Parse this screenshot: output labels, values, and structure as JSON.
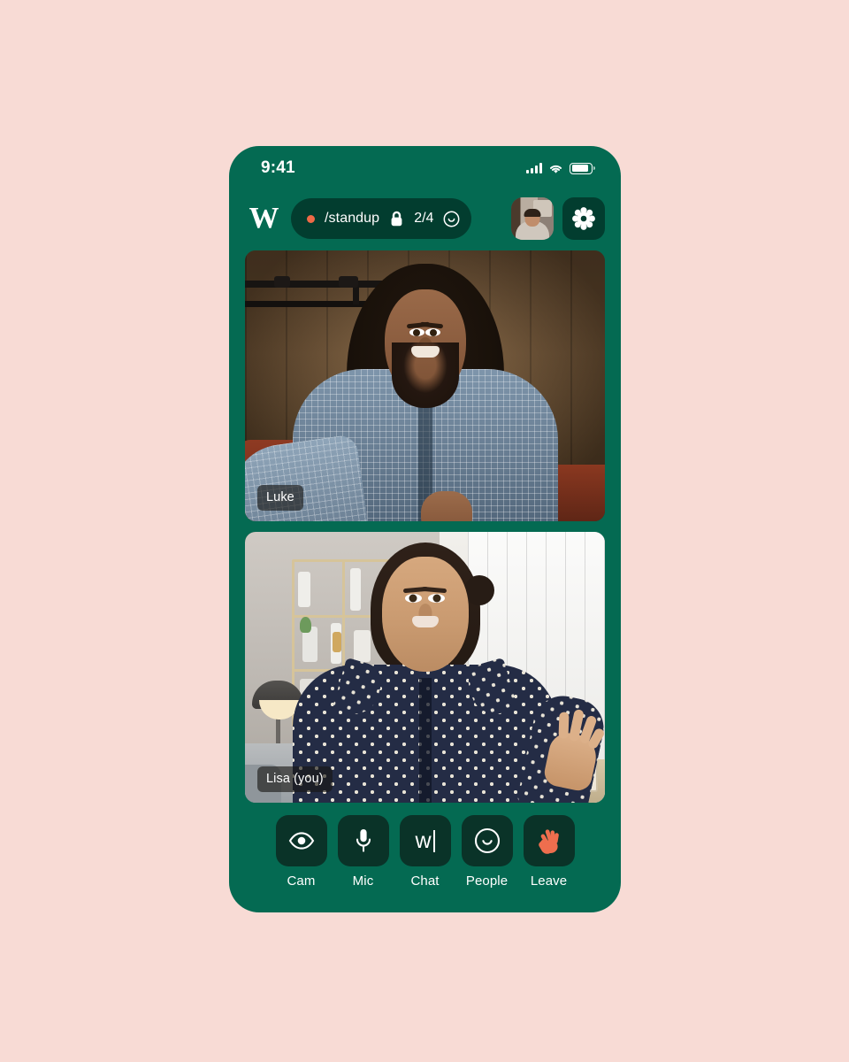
{
  "app": {
    "brand_letter": "W",
    "accent_green": "#046a52",
    "panel_green": "#023d2f",
    "button_green": "#0a3328",
    "page_background": "#f8dbd5",
    "accent_orange": "#ef6a47"
  },
  "status_bar": {
    "time": "9:41",
    "signal_icon": "cellular-signal-icon",
    "wifi_icon": "wifi-icon",
    "battery_icon": "battery-icon"
  },
  "header": {
    "logo_name": "wherebly-logo",
    "room": {
      "recording_dot": "recording-dot",
      "name": "/standup",
      "lock_icon": "lock-icon",
      "participants": "2/4",
      "face_icon": "smiley-face-icon"
    },
    "avatar_name": "self-avatar",
    "settings_icon": "gear-icon"
  },
  "participants": [
    {
      "name": "Luke",
      "tile": "video-tile-luke"
    },
    {
      "name": "Lisa (you)",
      "tile": "video-tile-lisa"
    }
  ],
  "controls": [
    {
      "label": "Cam",
      "icon": "eye-icon",
      "name": "cam-button"
    },
    {
      "label": "Mic",
      "icon": "microphone-icon",
      "name": "mic-button"
    },
    {
      "label": "Chat",
      "icon": "w-cursor-icon",
      "name": "chat-button"
    },
    {
      "label": "People",
      "icon": "smiley-face-icon",
      "name": "people-button"
    },
    {
      "label": "Leave",
      "icon": "waving-hand-icon",
      "name": "leave-button"
    }
  ]
}
